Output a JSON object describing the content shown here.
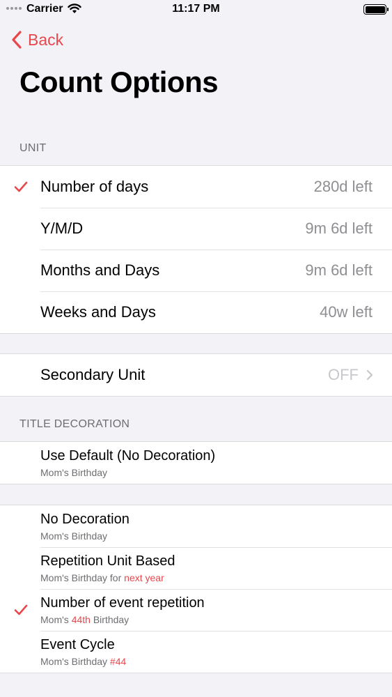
{
  "status_bar": {
    "carrier": "Carrier",
    "time": "11:17 PM"
  },
  "nav": {
    "back_label": "Back"
  },
  "page_title": "Count Options",
  "unit_section": {
    "header": "UNIT",
    "items": [
      {
        "label": "Number of days",
        "value": "280d left",
        "checked": true
      },
      {
        "label": "Y/M/D",
        "value": "9m 6d left",
        "checked": false
      },
      {
        "label": "Months and Days",
        "value": "9m 6d left",
        "checked": false
      },
      {
        "label": "Weeks and Days",
        "value": "40w left",
        "checked": false
      }
    ]
  },
  "secondary_unit": {
    "label": "Secondary Unit",
    "value": "OFF"
  },
  "title_decoration": {
    "header": "TITLE DECORATION",
    "default_item": {
      "title": "Use Default (No Decoration)",
      "subtitle": "Mom's Birthday"
    },
    "items": [
      {
        "title": "No Decoration",
        "sub_prefix": "Mom's Birthday",
        "sub_accent": "",
        "sub_suffix": "",
        "checked": false
      },
      {
        "title": "Repetition Unit Based",
        "sub_prefix": "Mom's Birthday for ",
        "sub_accent": "next year",
        "sub_suffix": "",
        "checked": false
      },
      {
        "title": "Number of event repetition",
        "sub_prefix": "Mom's ",
        "sub_accent": "44th",
        "sub_suffix": " Birthday",
        "checked": true
      },
      {
        "title": "Event Cycle",
        "sub_prefix": "Mom's Birthday ",
        "sub_accent": "#44",
        "sub_suffix": "",
        "checked": false
      }
    ]
  },
  "colors": {
    "accent": "#e8474c",
    "background": "#f2f2f7",
    "secondary_text": "#8e8e93"
  }
}
